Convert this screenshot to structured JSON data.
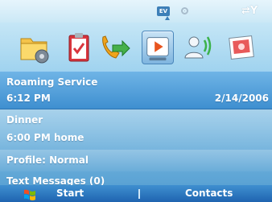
{
  "status_bar": {
    "ev_label": "EV",
    "icons": [
      "ev-icon",
      "sync-icon",
      "signal-icon"
    ]
  },
  "toolbar": {
    "icons": [
      "folder-settings-icon",
      "tasks-clipboard-icon",
      "phone-icon",
      "media-player-icon",
      "contact-beam-icon",
      "photo-icon"
    ],
    "selected_index": 3
  },
  "list": {
    "roaming": {
      "title": "Roaming Service",
      "time": "6:12 PM",
      "date": "2/14/2006"
    },
    "appointment": {
      "title": "Dinner",
      "detail": "6:00 PM home"
    },
    "profile": {
      "label": "Profile: Normal"
    },
    "messages": {
      "label": "Text Messages (0)"
    }
  },
  "softkeys": {
    "left": "Start",
    "right": "Contacts"
  },
  "colors": {
    "accent": "#3e8fd0",
    "bar": "#1f64b0"
  }
}
